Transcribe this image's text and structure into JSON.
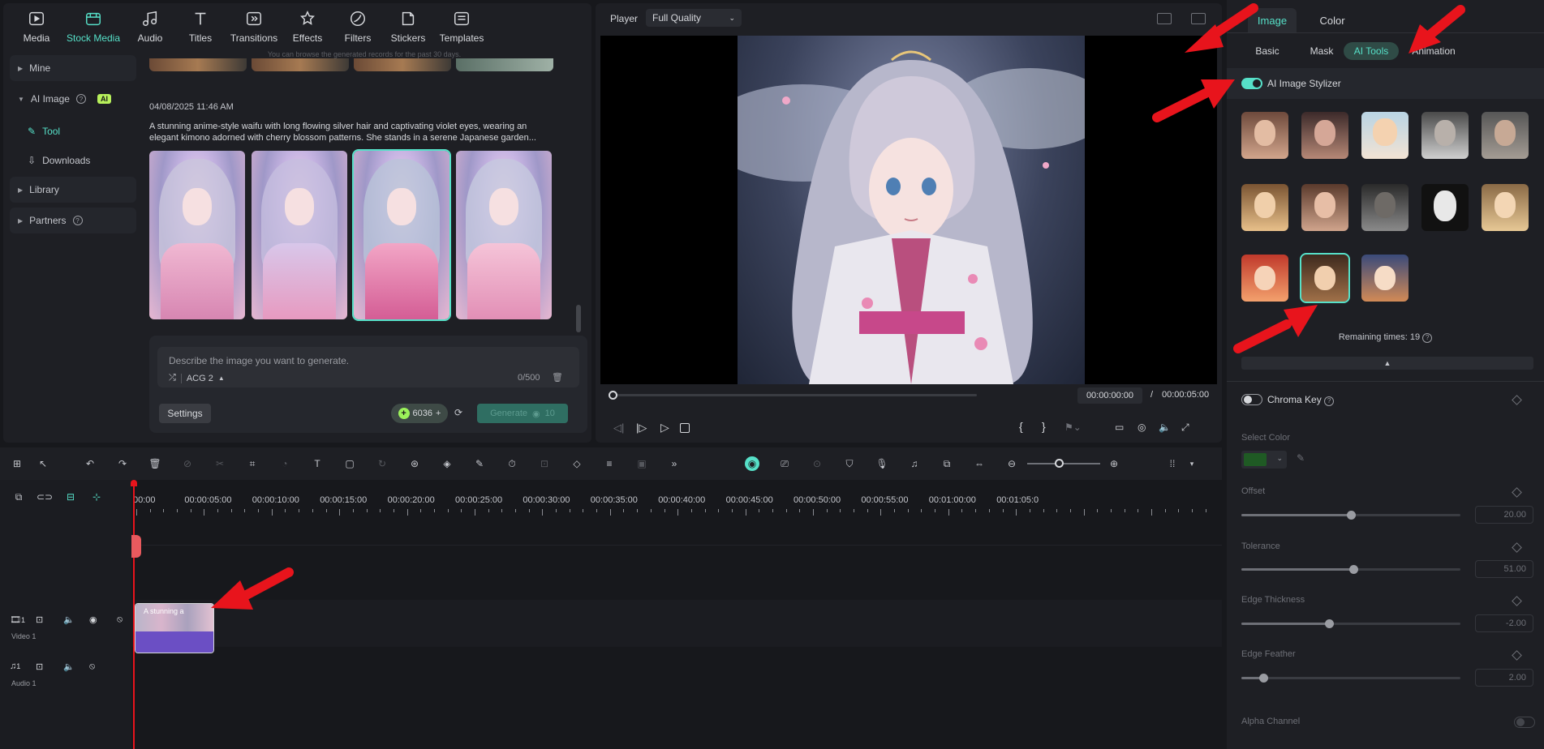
{
  "media_tabs": [
    {
      "label": "Media",
      "icon": "media-icon"
    },
    {
      "label": "Stock Media",
      "icon": "stock-media-icon"
    },
    {
      "label": "Audio",
      "icon": "audio-icon"
    },
    {
      "label": "Titles",
      "icon": "titles-icon"
    },
    {
      "label": "Transitions",
      "icon": "transitions-icon"
    },
    {
      "label": "Effects",
      "icon": "effects-icon"
    },
    {
      "label": "Filters",
      "icon": "filters-icon"
    },
    {
      "label": "Stickers",
      "icon": "stickers-icon"
    },
    {
      "label": "Templates",
      "icon": "templates-icon"
    }
  ],
  "side_nav": {
    "mine": "Mine",
    "ai_image": "AI Image",
    "ai_badge": "AI",
    "tool": "Tool",
    "downloads": "Downloads",
    "library": "Library",
    "partners": "Partners"
  },
  "generation": {
    "history_note": "You can browse the generated records for the past 30 days.",
    "timestamp": "04/08/2025 11:46 AM",
    "prompt_line1": "A stunning anime-style waifu with long flowing silver hair and captivating violet eyes, wearing an",
    "prompt_line2": "elegant kimono adorned with cherry blossom patterns. She stands in a serene Japanese garden..."
  },
  "prompt_box": {
    "placeholder": "Describe the image you want to generate.",
    "model": "ACG 2",
    "counter": "0/500",
    "settings_label": "Settings",
    "credits": "6036",
    "generate_label": "Generate",
    "generate_cost": "10"
  },
  "player": {
    "label": "Player",
    "quality": "Full Quality",
    "current_time": "00:00:00:00",
    "separator": "/",
    "total_time": "00:00:05:00"
  },
  "properties": {
    "tab_image": "Image",
    "tab_color": "Color",
    "sub_basic": "Basic",
    "sub_mask": "Mask",
    "sub_ai_tools": "AI Tools",
    "sub_animation": "Animation",
    "stylizer_label": "AI Image Stylizer",
    "remaining": "Remaining times: 19",
    "chroma_key": "Chroma Key",
    "select_color": "Select Color",
    "offset_label": "Offset",
    "offset_value": "20.00",
    "offset_level": 0.5,
    "tolerance_label": "Tolerance",
    "tolerance_value": "51.00",
    "tolerance_level": 0.51,
    "edge_thickness_label": "Edge Thickness",
    "edge_thickness_value": "-2.00",
    "edge_thickness_level": 0.4,
    "edge_feather_label": "Edge Feather",
    "edge_feather_value": "2.00",
    "edge_feather_level": 0.1,
    "alpha_channel": "Alpha Channel",
    "chroma_color": "#1f5a24"
  },
  "timeline": {
    "ruler": [
      "00:00",
      "00:00:05:00",
      "00:00:10:00",
      "00:00:15:00",
      "00:00:20:00",
      "00:00:25:00",
      "00:00:30:00",
      "00:00:35:00",
      "00:00:40:00",
      "00:00:45:00",
      "00:00:50:00",
      "00:00:55:00",
      "00:01:00:00",
      "00:01:05:0"
    ],
    "video_track": "Video 1",
    "audio_track": "Audio 1",
    "clip_label": "A stunning a",
    "track_num": "1"
  },
  "colors": {
    "accent": "#56e0c8",
    "arrow": "#e8141c",
    "clip": "#6b4fc4"
  }
}
